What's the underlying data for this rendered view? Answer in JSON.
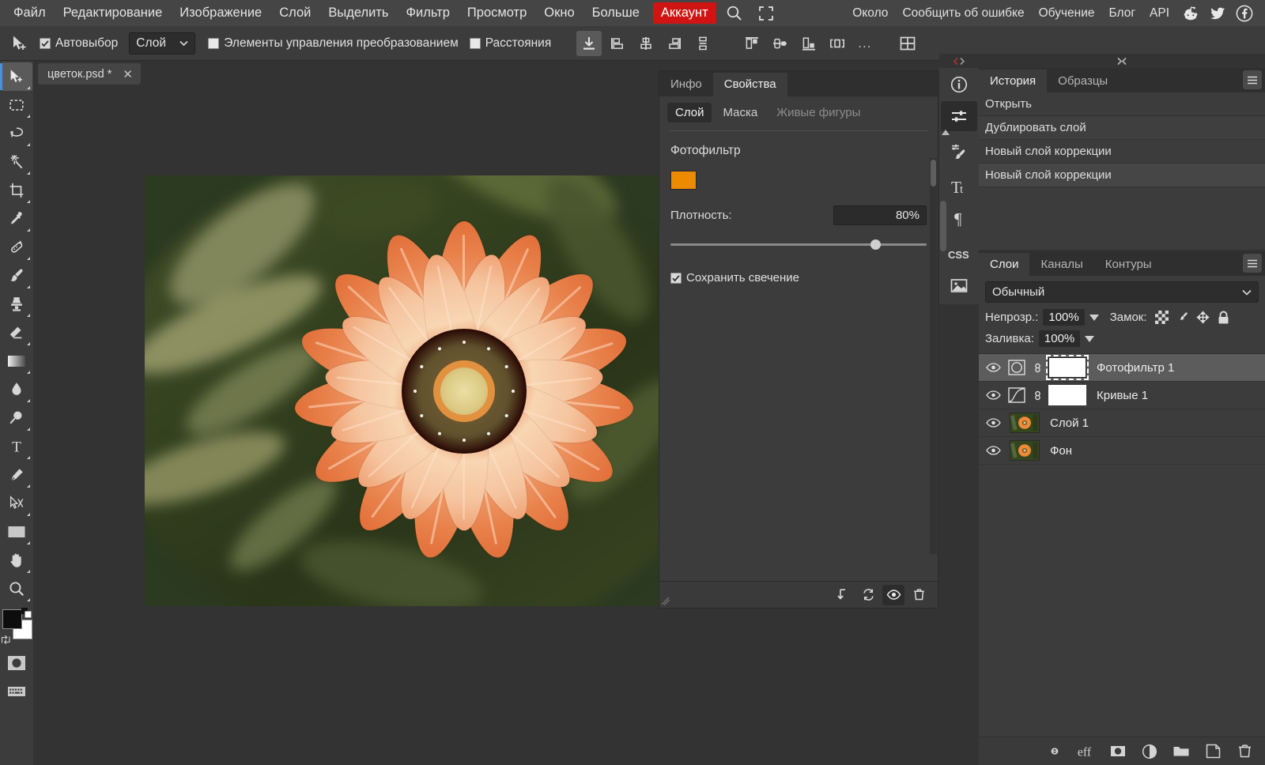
{
  "menubar": {
    "left_items": [
      {
        "label": "Файл",
        "name": "menu-file"
      },
      {
        "label": "Редактирование",
        "name": "menu-edit"
      },
      {
        "label": "Изображение",
        "name": "menu-image"
      },
      {
        "label": "Слой",
        "name": "menu-layer"
      },
      {
        "label": "Выделить",
        "name": "menu-select"
      },
      {
        "label": "Фильтр",
        "name": "menu-filter"
      },
      {
        "label": "Просмотр",
        "name": "menu-view"
      },
      {
        "label": "Окно",
        "name": "menu-window"
      },
      {
        "label": "Больше",
        "name": "menu-more"
      }
    ],
    "account_label": "Аккаунт",
    "account_color": "#d01414",
    "search_icon": "search-icon",
    "fullscreen_icon": "fullscreen-icon",
    "right_items": [
      {
        "label": "Около",
        "name": "menu-about"
      },
      {
        "label": "Сообщить об ошибке",
        "name": "menu-report-bug"
      },
      {
        "label": "Обучение",
        "name": "menu-learn"
      },
      {
        "label": "Блог",
        "name": "menu-blog"
      },
      {
        "label": "API",
        "name": "menu-api"
      }
    ],
    "social_icons": [
      "reddit-icon",
      "twitter-icon",
      "facebook-icon"
    ]
  },
  "optionsbar": {
    "tool_icon": "move-tool-icon",
    "autoselect_label": "Автовыбор",
    "autoselect_checked": true,
    "scope_value": "Слой",
    "transform_controls_label": "Элементы управления преобразованием",
    "transform_controls_checked": false,
    "distances_label": "Расстояния",
    "distances_checked": false,
    "align_icons": [
      "align-left-icon",
      "align-center-horizontal-icon",
      "align-right-icon",
      "align-distribute-icon"
    ],
    "distribute_icons": [
      "distribute-top-icon",
      "distribute-middle-icon",
      "distribute-bottom-icon",
      "distribute-spacing-icon"
    ],
    "more_label": "...",
    "grid_icon": "grid-icon"
  },
  "toolbar": {
    "tools": [
      {
        "name": "move-tool",
        "label": "Move",
        "selected": true
      },
      {
        "name": "marquee-tool",
        "label": "Rectangular Marquee"
      },
      {
        "name": "lasso-tool",
        "label": "Lasso"
      },
      {
        "name": "magic-wand-tool",
        "label": "Magic Wand"
      },
      {
        "name": "crop-tool",
        "label": "Crop"
      },
      {
        "name": "eyedropper-tool",
        "label": "Eyedropper"
      },
      {
        "name": "healing-brush-tool",
        "label": "Healing Brush"
      },
      {
        "name": "brush-tool",
        "label": "Brush"
      },
      {
        "name": "clone-stamp-tool",
        "label": "Clone Stamp"
      },
      {
        "name": "eraser-tool",
        "label": "Eraser"
      },
      {
        "name": "gradient-tool",
        "label": "Gradient"
      },
      {
        "name": "blur-tool",
        "label": "Blur"
      },
      {
        "name": "dodge-tool",
        "label": "Dodge"
      },
      {
        "name": "type-tool",
        "label": "Type"
      },
      {
        "name": "pen-tool",
        "label": "Pen"
      },
      {
        "name": "path-select-tool",
        "label": "Path Selection"
      },
      {
        "name": "shape-tool",
        "label": "Rectangle Shape"
      },
      {
        "name": "hand-tool",
        "label": "Hand"
      },
      {
        "name": "zoom-tool",
        "label": "Zoom"
      }
    ],
    "foreground_color": "#0d0d0d",
    "background_color": "#ffffff",
    "quickmask_icon": "quick-mask-icon",
    "screenmode_icon": "screen-mode-icon"
  },
  "document": {
    "tab_title": "цветок.psd *",
    "close_label": "✕"
  },
  "properties": {
    "tabs": [
      {
        "label": "Инфо",
        "active": false
      },
      {
        "label": "Свойства",
        "active": true
      }
    ],
    "subtabs": [
      {
        "label": "Слой",
        "active": true,
        "dim": false
      },
      {
        "label": "Маска",
        "active": false,
        "dim": false
      },
      {
        "label": "Живые фигуры",
        "active": false,
        "dim": true
      }
    ],
    "title": "Фотофильтр",
    "filter_color": "#ec8b00",
    "density_label": "Плотность:",
    "density_value": "80%",
    "density_percent": 80,
    "preserve_label": "Сохранить свечение",
    "preserve_checked": true,
    "footer_icons": [
      "clip-to-layer-icon",
      "reset-icon",
      "toggle-visibility-icon",
      "delete-icon"
    ]
  },
  "rail": {
    "buttons": [
      {
        "name": "info-icon",
        "active": false
      },
      {
        "name": "adjustments-icon",
        "active": true
      },
      {
        "name": "brush-settings-icon",
        "active": false
      },
      {
        "name": "character-icon",
        "active": false
      },
      {
        "name": "paragraph-icon",
        "active": false
      },
      {
        "name": "css-icon",
        "active": false
      },
      {
        "name": "image-icon",
        "active": false
      }
    ]
  },
  "history": {
    "tabs": [
      {
        "label": "История",
        "active": true
      },
      {
        "label": "Образцы",
        "active": false
      }
    ],
    "menu_icon": "panel-menu-icon",
    "items": [
      {
        "label": "Открыть",
        "current": false
      },
      {
        "label": "Дублировать слой",
        "current": false
      },
      {
        "label": "Новый слой коррекции",
        "current": false
      },
      {
        "label": "Новый слой коррекции",
        "current": true
      }
    ]
  },
  "layers": {
    "tabs": [
      {
        "label": "Слои",
        "active": true
      },
      {
        "label": "Каналы",
        "active": false
      },
      {
        "label": "Контуры",
        "active": false
      }
    ],
    "menu_icon": "panel-menu-icon",
    "blend_mode": "Обычный",
    "opacity_label": "Непрозр.:",
    "opacity_value": "100%",
    "lock_label": "Замок:",
    "lock_icons": [
      "lock-transparency-icon",
      "lock-pixels-icon",
      "lock-position-icon",
      "lock-all-icon"
    ],
    "fill_label": "Заливка:",
    "fill_value": "100%",
    "rows": [
      {
        "name": "Фотофильтр 1",
        "type": "adjustment-photofilter",
        "selected": true,
        "has_mask": true,
        "mask_selected": true,
        "visible": true
      },
      {
        "name": "Кривые 1",
        "type": "adjustment-curves",
        "selected": false,
        "has_mask": true,
        "mask_selected": false,
        "visible": true
      },
      {
        "name": "Слой 1",
        "type": "pixel",
        "selected": false,
        "has_mask": false,
        "visible": true
      },
      {
        "name": "Фон",
        "type": "pixel",
        "selected": false,
        "has_mask": false,
        "visible": true
      }
    ],
    "footer_icons": [
      "link-layers-icon",
      "layer-effects-icon",
      "add-mask-icon",
      "new-adjustment-icon",
      "new-group-icon",
      "new-layer-icon",
      "delete-layer-icon"
    ]
  }
}
